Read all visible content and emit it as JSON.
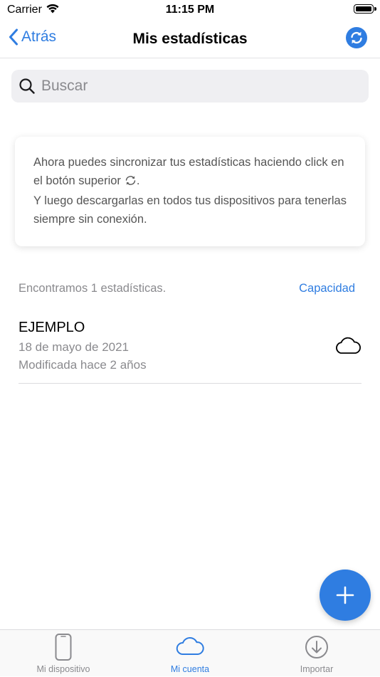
{
  "status": {
    "carrier": "Carrier",
    "time": "11:15 PM"
  },
  "nav": {
    "back_label": "Atrás",
    "title": "Mis estadísticas"
  },
  "search": {
    "placeholder": "Buscar"
  },
  "info": {
    "line1": "Ahora puedes sincronizar tus estadísticas haciendo click en el botón superior",
    "line1_end": ".",
    "line2": "Y luego descargarlas en todos tus dispositivos para tenerlas siempre sin conexión."
  },
  "list": {
    "found_text": "Encontramos 1 estadísticas.",
    "capacity_label": "Capacidad",
    "items": [
      {
        "title": "EJEMPLO",
        "date": "18 de mayo de 2021",
        "modified": "Modificada hace 2 años",
        "icon": "cloud-icon"
      }
    ]
  },
  "tabs": [
    {
      "label": "Mi dispositivo",
      "icon": "phone-icon",
      "active": false
    },
    {
      "label": "Mi cuenta",
      "icon": "cloud-icon",
      "active": true
    },
    {
      "label": "Importar",
      "icon": "download-icon",
      "active": false
    }
  ],
  "colors": {
    "accent": "#2f7de1",
    "secondary_text": "#8a8a8e",
    "search_bg": "#efeff2"
  }
}
